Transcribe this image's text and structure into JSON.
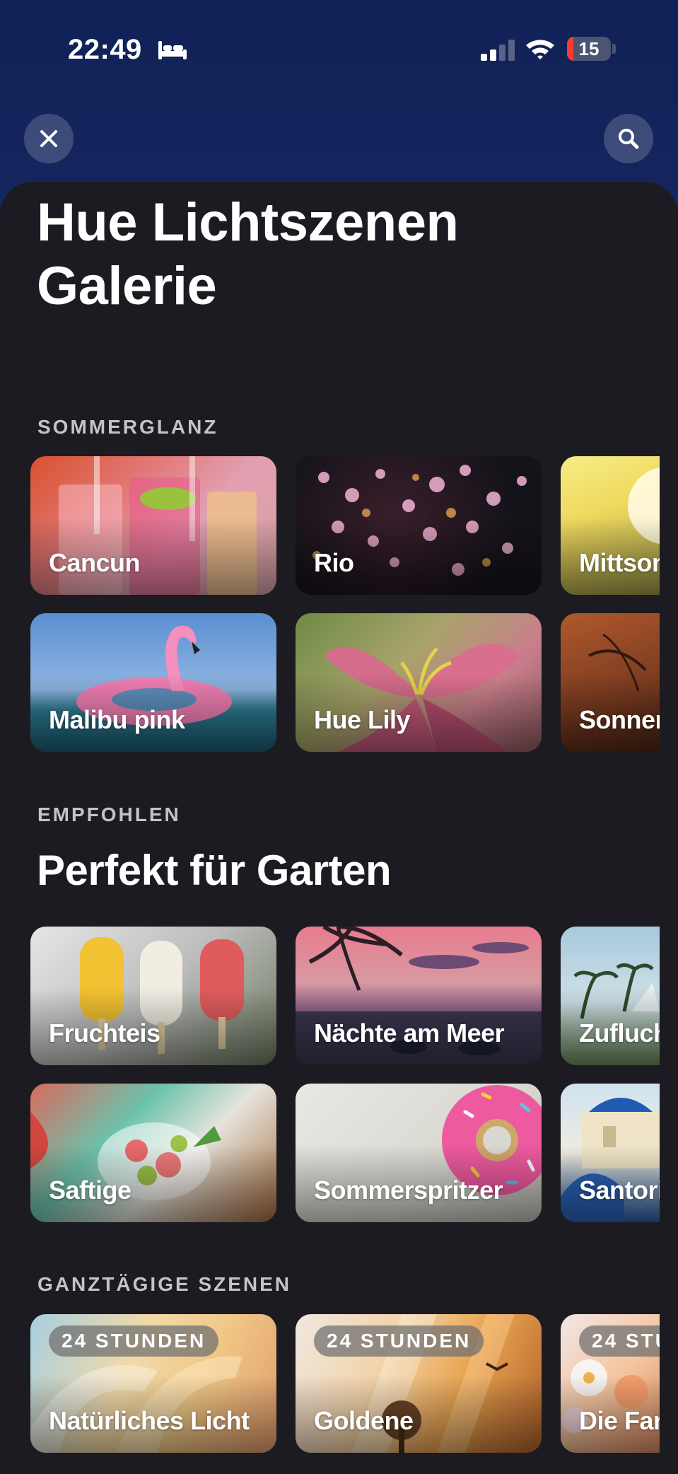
{
  "status_bar": {
    "time": "22:49",
    "battery": "15"
  },
  "page": {
    "title_line1": "Hue Lichtszenen",
    "title_line2": "Galerie"
  },
  "sections": {
    "summer": {
      "label": "SOMMERGLANZ",
      "row1": [
        "Cancun",
        "Rio",
        "Mittsom"
      ],
      "row2": [
        "Malibu pink",
        "Hue Lily",
        "Sonnenu"
      ]
    },
    "recommended": {
      "label": "EMPFOHLEN",
      "heading": "Perfekt für Garten",
      "row1": [
        "Fruchteis",
        "Nächte am Meer",
        "Zuflucht"
      ],
      "row2": [
        "Saftige",
        "Sommerspritzer",
        "Santorin"
      ]
    },
    "all_day": {
      "label": "GANZTÄGIGE SZENEN",
      "tag": "24 STUNDEN",
      "tag_partial": "24 STU",
      "row1": [
        "Natürliches Licht",
        "Goldene",
        "Die Farb"
      ]
    }
  },
  "icons": {
    "close": "close-icon",
    "search": "search-icon",
    "sleep": "bed-icon",
    "signal": "signal-icon",
    "wifi": "wifi-icon"
  },
  "colors": {
    "background": "#1b1b21",
    "header": "#12235a",
    "battery_low": "#ff3b30"
  }
}
